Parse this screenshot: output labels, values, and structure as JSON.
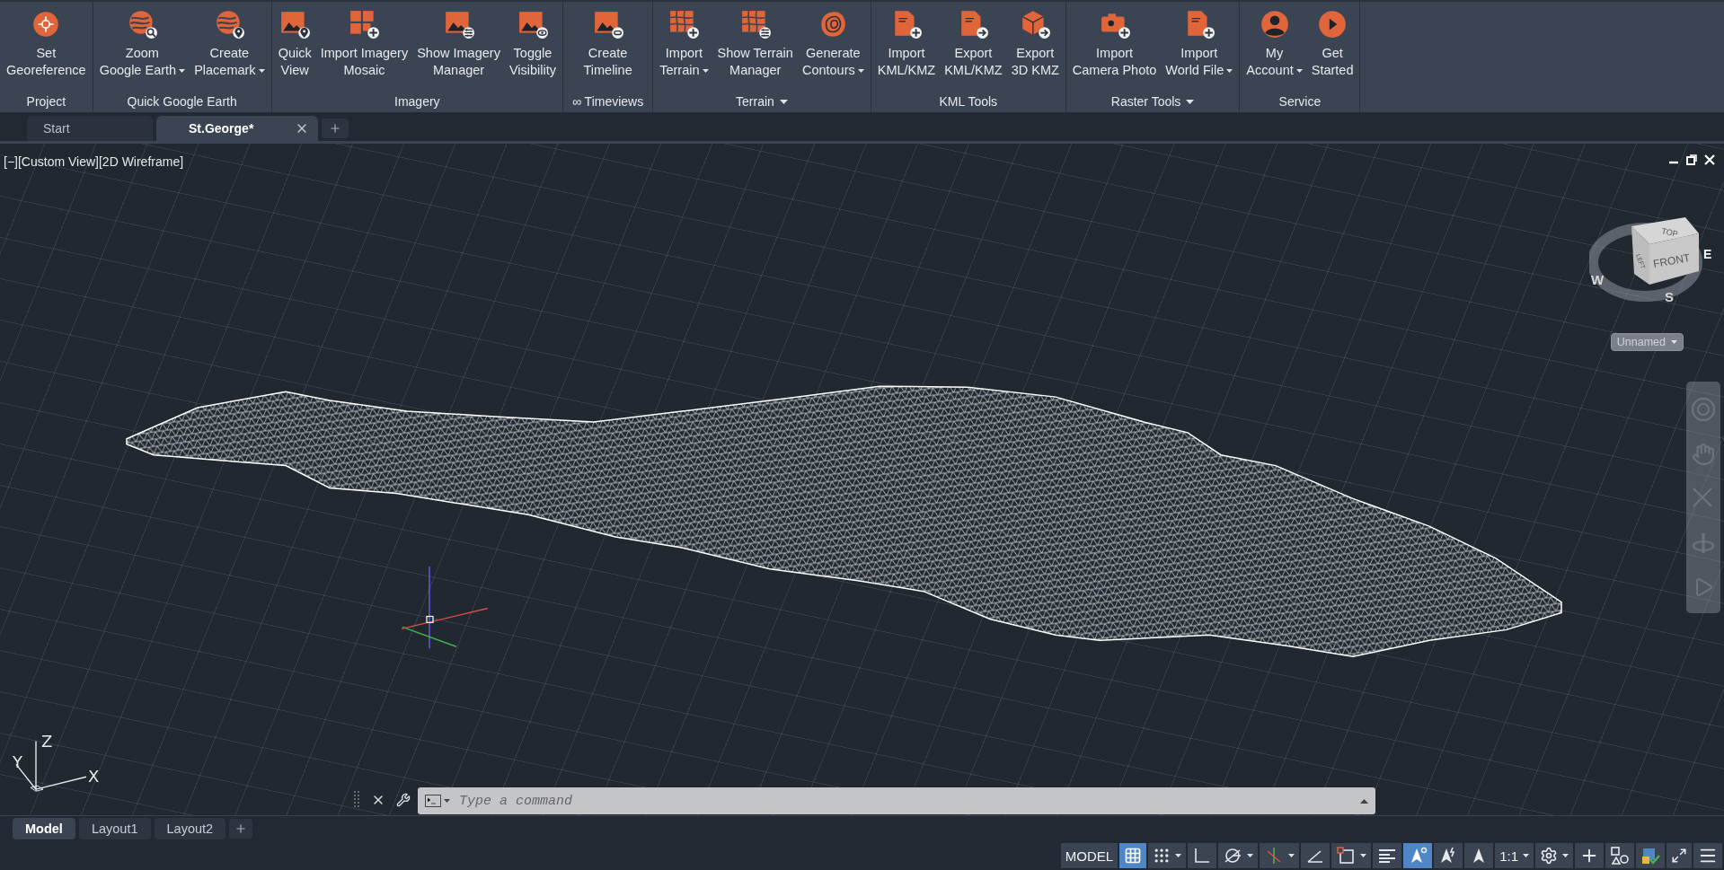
{
  "ribbon": {
    "groups": [
      {
        "label": "Project",
        "menu": false,
        "buttons": [
          {
            "lines": [
              "Set",
              "Georeference"
            ],
            "menu": false,
            "kind": "target"
          }
        ]
      },
      {
        "label": "Quick Google Earth",
        "menu": false,
        "buttons": [
          {
            "lines": [
              "Zoom",
              "Google Earth"
            ],
            "menu": true,
            "kind": "globe-zoom"
          },
          {
            "lines": [
              "Create",
              "Placemark"
            ],
            "menu": true,
            "kind": "globe-pin"
          }
        ]
      },
      {
        "label": "Imagery",
        "menu": false,
        "buttons": [
          {
            "lines": [
              "Quick",
              "View"
            ],
            "menu": false,
            "kind": "image-pin"
          },
          {
            "lines": [
              "Import Imagery",
              "Mosaic"
            ],
            "menu": false,
            "kind": "tiles-plus"
          },
          {
            "lines": [
              "Show Imagery",
              "Manager"
            ],
            "menu": false,
            "kind": "image-sliders"
          },
          {
            "lines": [
              "Toggle",
              "Visibility"
            ],
            "menu": false,
            "kind": "image-eye"
          }
        ]
      },
      {
        "label": "∞ Timeviews",
        "menu": false,
        "buttons": [
          {
            "lines": [
              "Create",
              "Timeline"
            ],
            "menu": false,
            "kind": "image-link"
          }
        ]
      },
      {
        "label": "Terrain",
        "menu": true,
        "buttons": [
          {
            "lines": [
              "Import",
              "Terrain"
            ],
            "menu": true,
            "kind": "mesh-plus"
          },
          {
            "lines": [
              "Show Terrain",
              "Manager"
            ],
            "menu": false,
            "kind": "mesh-sliders"
          },
          {
            "lines": [
              "Generate",
              "Contours"
            ],
            "menu": true,
            "kind": "contour"
          }
        ]
      },
      {
        "label": "KML Tools",
        "menu": false,
        "buttons": [
          {
            "lines": [
              "Import",
              "KML/KMZ"
            ],
            "menu": false,
            "kind": "doc-plus"
          },
          {
            "lines": [
              "Export",
              "KML/KMZ"
            ],
            "menu": false,
            "kind": "doc-arrow"
          },
          {
            "lines": [
              "Export",
              "3D KMZ"
            ],
            "menu": false,
            "kind": "cube-arrow"
          }
        ]
      },
      {
        "label": "Raster Tools",
        "menu": true,
        "buttons": [
          {
            "lines": [
              "Import",
              "Camera Photo"
            ],
            "menu": false,
            "kind": "camera-plus"
          },
          {
            "lines": [
              "Import",
              "World File"
            ],
            "menu": true,
            "kind": "file-plus"
          }
        ]
      },
      {
        "label": "Service",
        "menu": false,
        "buttons": [
          {
            "lines": [
              "My",
              "Account"
            ],
            "menu": true,
            "kind": "person"
          },
          {
            "lines": [
              "Get",
              "Started"
            ],
            "menu": false,
            "kind": "play"
          }
        ]
      }
    ]
  },
  "document_tabs": [
    {
      "label": "Start",
      "selected": false
    },
    {
      "label": "St.George*",
      "selected": true
    }
  ],
  "viewport": {
    "view_label": "[−][Custom View][2D Wireframe]",
    "viewcube": {
      "faces": [
        "TOP",
        "FRONT",
        "LEFT"
      ],
      "compass": [
        "W",
        "E",
        "S"
      ],
      "view_menu": "Unnamed"
    },
    "ucs_axes": [
      "X",
      "Y",
      "Z"
    ]
  },
  "command_line": {
    "placeholder": "Type a command"
  },
  "layout_tabs": [
    {
      "label": "Model",
      "selected": true
    },
    {
      "label": "Layout1",
      "selected": false
    },
    {
      "label": "Layout2",
      "selected": false
    }
  ],
  "status_bar": [
    {
      "kind": "text",
      "label": "MODEL",
      "on": false,
      "menu": false
    },
    {
      "kind": "grid",
      "on": true,
      "menu": false
    },
    {
      "kind": "snap",
      "on": false,
      "menu": true
    },
    {
      "kind": "ortho",
      "on": false,
      "menu": false
    },
    {
      "kind": "polar",
      "on": false,
      "menu": true
    },
    {
      "kind": "track",
      "on": false,
      "menu": true
    },
    {
      "kind": "angle",
      "on": false,
      "menu": false
    },
    {
      "kind": "select",
      "on": false,
      "menu": true
    },
    {
      "kind": "lineweight",
      "on": false,
      "menu": false
    },
    {
      "kind": "annotation",
      "on": true,
      "menu": false
    },
    {
      "kind": "autoscale",
      "on": false,
      "menu": false
    },
    {
      "kind": "annovis",
      "on": false,
      "menu": false
    },
    {
      "kind": "text",
      "label": "1:1",
      "on": false,
      "menu": true
    },
    {
      "kind": "gear",
      "on": false,
      "menu": true
    },
    {
      "kind": "plus",
      "on": false,
      "menu": false
    },
    {
      "kind": "isolate",
      "on": false,
      "menu": false
    },
    {
      "kind": "hardware",
      "on": false,
      "menu": false
    },
    {
      "kind": "fullscreen",
      "on": false,
      "menu": false
    },
    {
      "kind": "menu",
      "on": false,
      "menu": false
    }
  ]
}
